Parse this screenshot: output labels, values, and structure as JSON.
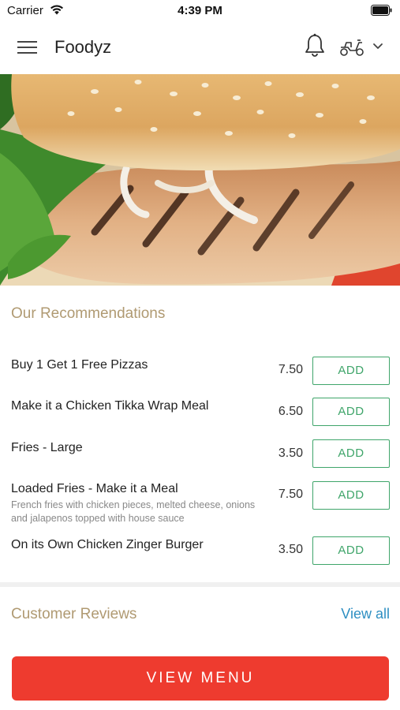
{
  "status_bar": {
    "carrier": "Carrier",
    "time": "4:39 PM"
  },
  "header": {
    "title": "Foodyz"
  },
  "icons": {
    "menu": "hamburger-menu-icon",
    "notifications": "bell-icon",
    "delivery": "scooter-icon",
    "dropdown": "chevron-down-icon"
  },
  "recommendations": {
    "title": "Our Recommendations",
    "items": [
      {
        "name": "Buy 1 Get 1 Free Pizzas",
        "description": "",
        "price": "7.50",
        "button": "ADD"
      },
      {
        "name": "Make it a Chicken Tikka Wrap Meal",
        "description": "",
        "price": "6.50",
        "button": "ADD"
      },
      {
        "name": "Fries - Large",
        "description": "",
        "price": "3.50",
        "button": "ADD"
      },
      {
        "name": "Loaded Fries - Make it a Meal",
        "description": "French fries with chicken pieces, melted cheese, onions and jalapenos topped with house sauce",
        "price": "7.50",
        "button": "ADD"
      },
      {
        "name": "On its Own Chicken Zinger Burger",
        "description": "",
        "price": "3.50",
        "button": "ADD"
      }
    ]
  },
  "reviews": {
    "title": "Customer Reviews",
    "view_all": "View all"
  },
  "cta": {
    "label": "VIEW MENU"
  },
  "colors": {
    "accent_red": "#ee3b2f",
    "add_green": "#3fa56a",
    "section_gold": "#b09a72",
    "link_blue": "#2e8fc2"
  }
}
